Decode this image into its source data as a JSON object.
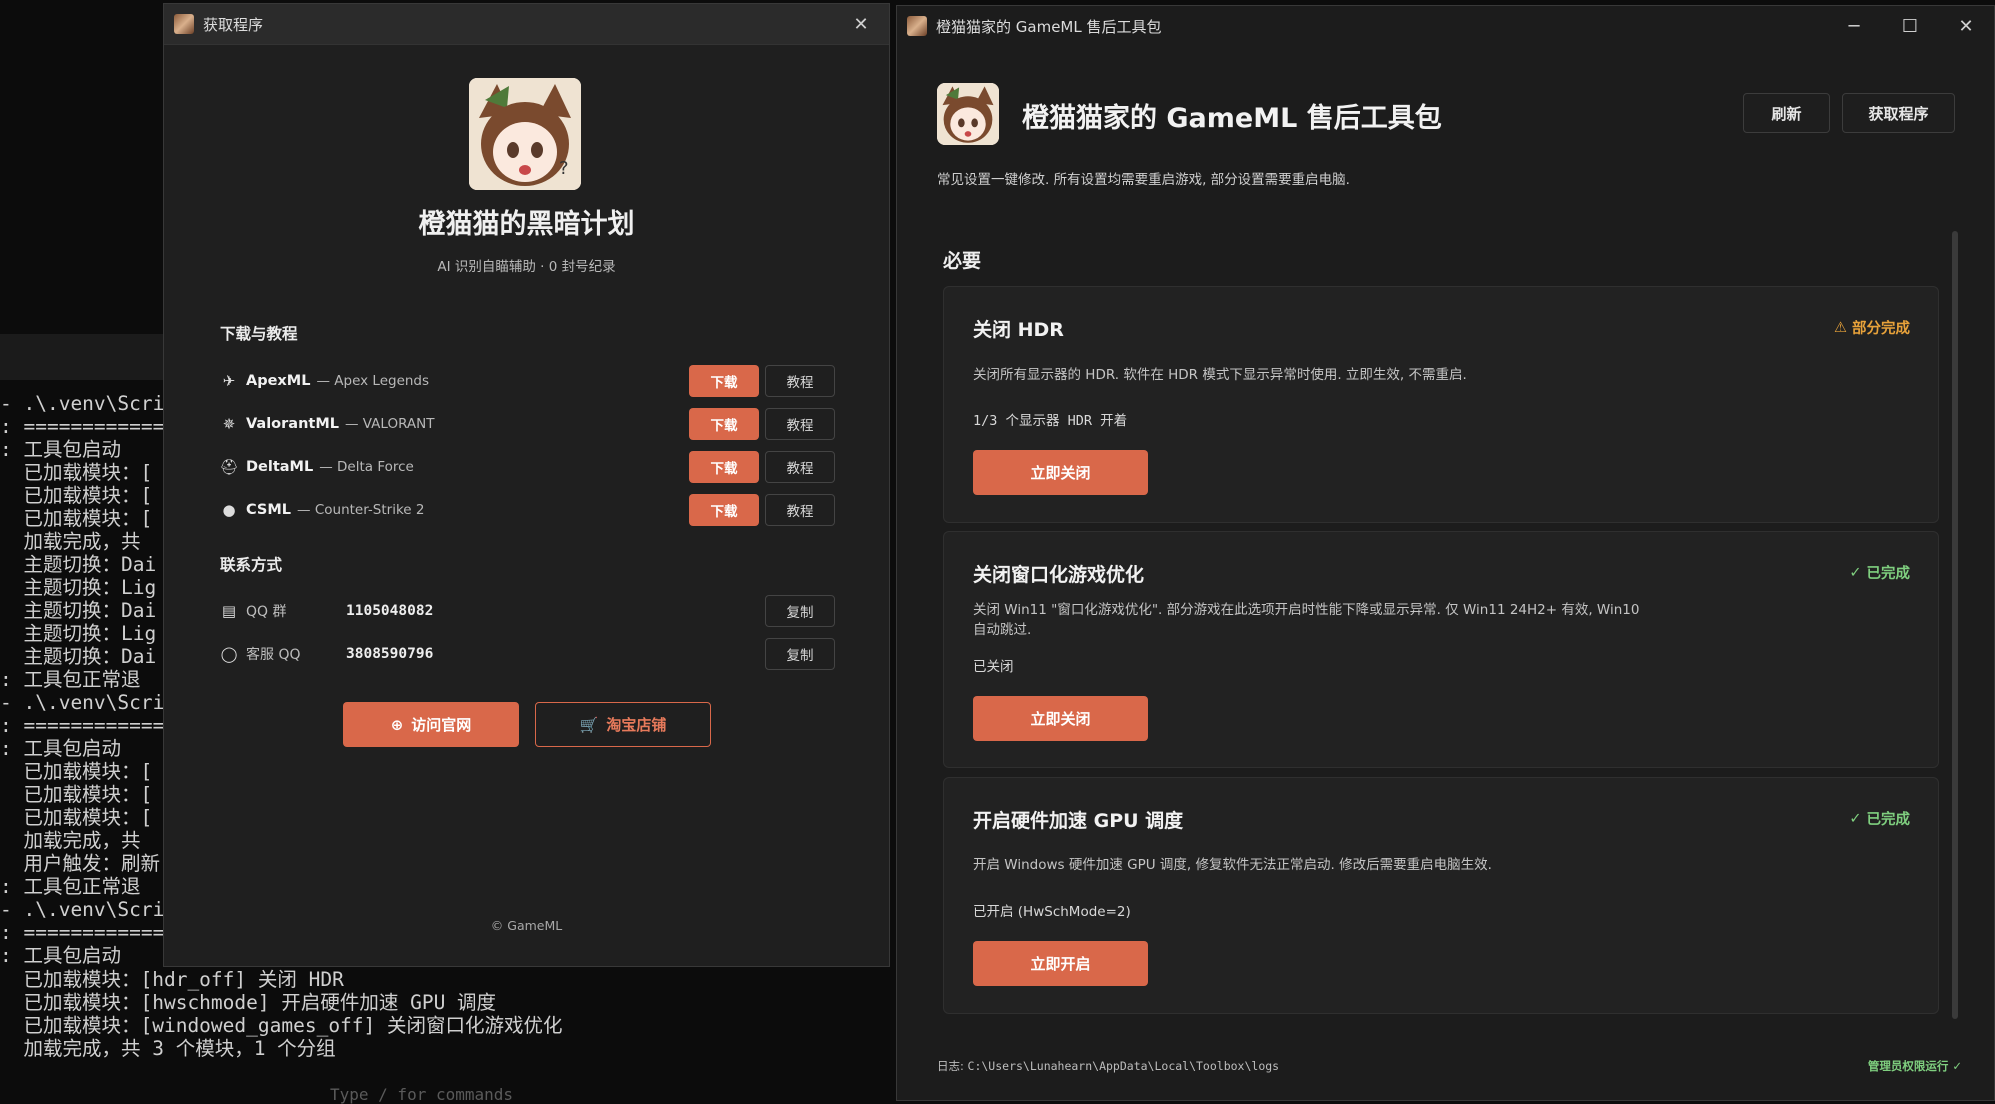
{
  "terminal": {
    "lines_top": [
      "- .\\.venv\\Scrip",
      ": ============",
      ": 工具包启动",
      "  已加载模块：[",
      "  已加载模块：[",
      "  已加载模块：[",
      "  加载完成，共",
      "  主题切换：Dai",
      "  主题切换：Lig",
      "  主题切换：Dai",
      "  主题切换：Lig",
      "  主题切换：Dai",
      ": 工具包正常退",
      "- .\\.venv\\Scrip",
      ": ============",
      ": 工具包启动",
      "  已加载模块：[",
      "  已加载模块：[",
      "  已加载模块：[",
      "  加载完成，共",
      "  用户触发：刷新",
      ": 工具包正常退",
      "- .\\.venv\\Scrip",
      ": ============",
      ": 工具包启动"
    ],
    "lines_bottom": [
      "  已加载模块：[hdr_off] 关闭 HDR",
      "  已加载模块：[hwschmode] 开启硬件加速 GPU 调度",
      "  已加载模块：[windowed_games_off] 关闭窗口化游戏优化",
      "  加载完成，共 3 个模块，1 个分组"
    ],
    "tail": "Type / for commands"
  },
  "dialog": {
    "title": "获取程序",
    "heading": "橙猫猫的黑暗计划",
    "subtitle": "AI 识别自瞄辅助 · 0 封号纪录",
    "downloads_label": "下载与教程",
    "products": [
      {
        "name": "ApexML",
        "game": "— Apex Legends",
        "download": "下载",
        "tutorial": "教程"
      },
      {
        "name": "ValorantML",
        "game": "— VALORANT",
        "download": "下载",
        "tutorial": "教程"
      },
      {
        "name": "DeltaML",
        "game": "— Delta Force",
        "download": "下载",
        "tutorial": "教程"
      },
      {
        "name": "CSML",
        "game": "— Counter-Strike 2",
        "download": "下载",
        "tutorial": "教程"
      }
    ],
    "contact_label": "联系方式",
    "contacts": [
      {
        "label": "QQ 群",
        "value": "1105048082",
        "copy": "复制"
      },
      {
        "label": "客服 QQ",
        "value": "3808590796",
        "copy": "复制"
      }
    ],
    "visit_site": "访问官网",
    "taobao": "淘宝店铺",
    "copyright": "© GameML"
  },
  "main": {
    "window_title": "橙猫猫家的 GameML 售后工具包",
    "title": "橙猫猫家的 GameML 售后工具包",
    "description": "常见设置一键修改. 所有设置均需要重启游戏, 部分设置需要重启电脑.",
    "refresh": "刷新",
    "get_program": "获取程序",
    "group_title": "必要",
    "cards": [
      {
        "title": "关闭 HDR",
        "status": "部分完成",
        "desc": "关闭所有显示器的 HDR. 软件在 HDR 模式下显示异常时使用. 立即生效, 不需重启.",
        "state": "1/3 个显示器 HDR 开着",
        "button": "立即关闭"
      },
      {
        "title": "关闭窗口化游戏优化",
        "status": "已完成",
        "desc": "关闭 Win11 \"窗口化游戏优化\". 部分游戏在此选项开启时性能下降或显示异常. 仅 Win11 24H2+ 有效, Win10 自动跳过.",
        "state": "已关闭",
        "button": "立即关闭"
      },
      {
        "title": "开启硬件加速 GPU 调度",
        "status": "已完成",
        "desc": "开启 Windows 硬件加速 GPU 调度, 修复软件无法正常启动. 修改后需要重启电脑生效.",
        "state": "已开启 (HwSchMode=2)",
        "button": "立即开启"
      }
    ],
    "log_label": "日志:",
    "log_path": "C:\\Users\\Lunahearn\\AppData\\Local\\Toolbox\\logs",
    "admin_status": "管理员权限运行 ✓"
  },
  "colors": {
    "accent": "#d9684a",
    "warning": "#e8a23a",
    "success": "#7fcf7f"
  }
}
